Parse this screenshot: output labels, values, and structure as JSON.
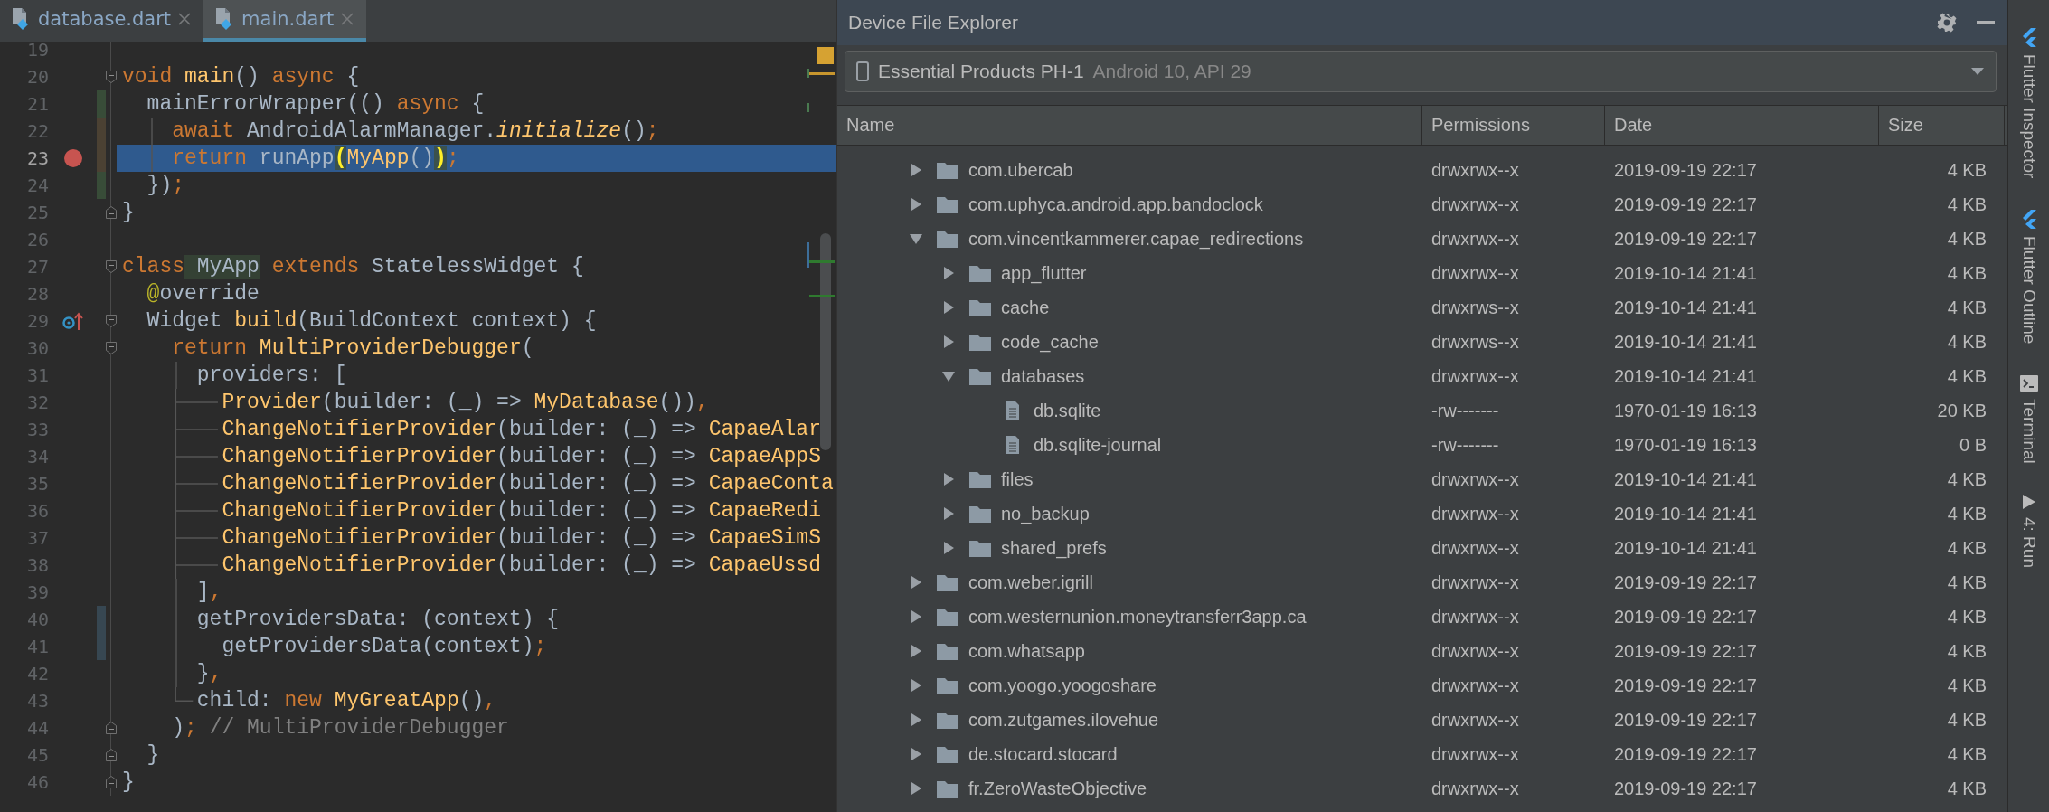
{
  "editor": {
    "tabs": [
      {
        "label": "database.dart",
        "selected": false
      },
      {
        "label": "main.dart",
        "selected": true
      }
    ],
    "lines": [
      {
        "number": "19",
        "current": false,
        "breakpoint": false,
        "override": false
      },
      {
        "number": "20",
        "current": false,
        "breakpoint": false,
        "override": false,
        "fold": {
          "end": false
        },
        "tokens": [
          {
            "kind": "kw",
            "text": "void"
          },
          {
            "kind": "fn",
            "text": " main"
          },
          {
            "kind": "plain",
            "text": "() "
          },
          {
            "kind": "kw",
            "text": "async"
          },
          {
            "kind": "plain",
            "text": " {"
          }
        ]
      },
      {
        "number": "21",
        "current": false,
        "breakpoint": false,
        "override": false,
        "change_marker": {
          "color": "#384c38"
        },
        "tokens": [
          {
            "kind": "plain",
            "text": "  mainErrorWrapper(() "
          },
          {
            "kind": "kw",
            "text": "async"
          },
          {
            "kind": "plain",
            "text": " {"
          }
        ]
      },
      {
        "number": "22",
        "current": false,
        "breakpoint": false,
        "override": false,
        "change_marker": {
          "color": "#4b4133"
        },
        "guide": {
          "branch": false
        },
        "tokens": [
          {
            "kind": "kw",
            "text": "    await"
          },
          {
            "kind": "plain",
            "text": " AndroidAlarmManager."
          },
          {
            "kind": "italic",
            "text": "initialize"
          },
          {
            "kind": "plain",
            "text": "()"
          },
          {
            "kind": "kw",
            "text": ";"
          }
        ]
      },
      {
        "number": "23",
        "current": true,
        "breakpoint": true,
        "override": false,
        "change_marker": {
          "color": "#4b4133"
        },
        "guide": {
          "branch": false
        },
        "tokens": [
          {
            "kind": "kw",
            "text": "    return"
          },
          {
            "kind": "plain",
            "text": " runApp"
          },
          {
            "kind": "brace",
            "text": "("
          },
          {
            "kind": "fn",
            "text": "MyApp"
          },
          {
            "kind": "plain",
            "text": "()"
          },
          {
            "kind": "brace",
            "text": ")"
          },
          {
            "kind": "kw",
            "text": ";"
          }
        ]
      },
      {
        "number": "24",
        "current": false,
        "breakpoint": false,
        "override": false,
        "change_marker": {
          "color": "#384c38"
        },
        "tokens": [
          {
            "kind": "plain",
            "text": "  })"
          },
          {
            "kind": "kw",
            "text": ";"
          }
        ]
      },
      {
        "number": "25",
        "current": false,
        "breakpoint": false,
        "override": false,
        "fold": {
          "end": true
        },
        "tokens": [
          {
            "kind": "plain",
            "text": "}"
          }
        ]
      },
      {
        "number": "26",
        "current": false,
        "breakpoint": false,
        "override": false
      },
      {
        "number": "27",
        "current": false,
        "breakpoint": false,
        "override": false,
        "fold": {
          "end": false
        },
        "tokens": [
          {
            "kind": "kw",
            "text": "class"
          },
          {
            "kind": "decl",
            "text": " MyApp"
          },
          {
            "kind": "kw",
            "text": " extends"
          },
          {
            "kind": "plain",
            "text": " StatelessWidget {"
          }
        ]
      },
      {
        "number": "28",
        "current": false,
        "breakpoint": false,
        "override": false,
        "tokens": [
          {
            "kind": "anno",
            "text": "  @"
          },
          {
            "kind": "plain",
            "text": "override"
          }
        ]
      },
      {
        "number": "29",
        "current": false,
        "breakpoint": false,
        "override": true,
        "fold": {
          "end": false
        },
        "tokens": [
          {
            "kind": "plain",
            "text": "  Widget "
          },
          {
            "kind": "fn",
            "text": "build"
          },
          {
            "kind": "plain",
            "text": "(BuildContext context) {"
          }
        ]
      },
      {
        "number": "30",
        "current": false,
        "breakpoint": false,
        "override": false,
        "fold": {
          "end": false
        },
        "tokens": [
          {
            "kind": "kw",
            "text": "    return"
          },
          {
            "kind": "fn",
            "text": " MultiProviderDebugger"
          },
          {
            "kind": "plain",
            "text": "("
          }
        ]
      },
      {
        "number": "31",
        "current": false,
        "breakpoint": false,
        "override": false,
        "guide": {
          "branch": false
        },
        "tokens": [
          {
            "kind": "plain",
            "text": "      providers: ["
          }
        ]
      },
      {
        "number": "32",
        "current": false,
        "breakpoint": false,
        "override": false,
        "guide": {
          "branch": true
        },
        "tokens": [
          {
            "kind": "fn",
            "text": "        Provider"
          },
          {
            "kind": "plain",
            "text": "(builder: (_) => "
          },
          {
            "kind": "fn",
            "text": "MyDatabase"
          },
          {
            "kind": "plain",
            "text": "())"
          },
          {
            "kind": "kw",
            "text": ","
          }
        ]
      },
      {
        "number": "33",
        "current": false,
        "breakpoint": false,
        "override": false,
        "guide": {
          "branch": true
        },
        "tokens": [
          {
            "kind": "fn",
            "text": "        ChangeNotifierProvider"
          },
          {
            "kind": "plain",
            "text": "(builder: (_) => "
          },
          {
            "kind": "fn",
            "text": "CapaeAlar"
          }
        ]
      },
      {
        "number": "34",
        "current": false,
        "breakpoint": false,
        "override": false,
        "guide": {
          "branch": true
        },
        "tokens": [
          {
            "kind": "fn",
            "text": "        ChangeNotifierProvider"
          },
          {
            "kind": "plain",
            "text": "(builder: (_) => "
          },
          {
            "kind": "fn",
            "text": "CapaeAppS"
          }
        ]
      },
      {
        "number": "35",
        "current": false,
        "breakpoint": false,
        "override": false,
        "guide": {
          "branch": true
        },
        "tokens": [
          {
            "kind": "fn",
            "text": "        ChangeNotifierProvider"
          },
          {
            "kind": "plain",
            "text": "(builder: (_) => "
          },
          {
            "kind": "fn",
            "text": "CapaeConta"
          }
        ]
      },
      {
        "number": "36",
        "current": false,
        "breakpoint": false,
        "override": false,
        "guide": {
          "branch": true
        },
        "tokens": [
          {
            "kind": "fn",
            "text": "        ChangeNotifierProvider"
          },
          {
            "kind": "plain",
            "text": "(builder: (_) => "
          },
          {
            "kind": "fn",
            "text": "CapaeRedi"
          }
        ]
      },
      {
        "number": "37",
        "current": false,
        "breakpoint": false,
        "override": false,
        "guide": {
          "branch": true
        },
        "tokens": [
          {
            "kind": "fn",
            "text": "        ChangeNotifierProvider"
          },
          {
            "kind": "plain",
            "text": "(builder: (_) => "
          },
          {
            "kind": "fn",
            "text": "CapaeSimS"
          }
        ]
      },
      {
        "number": "38",
        "current": false,
        "breakpoint": false,
        "override": false,
        "guide": {
          "branch": true
        },
        "tokens": [
          {
            "kind": "fn",
            "text": "        ChangeNotifierProvider"
          },
          {
            "kind": "plain",
            "text": "(builder: (_) => "
          },
          {
            "kind": "fn",
            "text": "CapaeUssd"
          }
        ]
      },
      {
        "number": "39",
        "current": false,
        "breakpoint": false,
        "override": false,
        "guide": {
          "branch": false
        },
        "tokens": [
          {
            "kind": "plain",
            "text": "      ]"
          },
          {
            "kind": "kw",
            "text": ","
          }
        ]
      },
      {
        "number": "40",
        "current": false,
        "breakpoint": false,
        "override": false,
        "change_marker": {
          "color": "#374752"
        },
        "guide": {
          "branch": false
        },
        "tokens": [
          {
            "kind": "plain",
            "text": "      getProvidersData: (context) {"
          }
        ]
      },
      {
        "number": "41",
        "current": false,
        "breakpoint": false,
        "override": false,
        "change_marker": {
          "color": "#374752"
        },
        "guide": {
          "branch": false
        },
        "tokens": [
          {
            "kind": "plain",
            "text": "        getProvidersData(context)"
          },
          {
            "kind": "kw",
            "text": ";"
          }
        ]
      },
      {
        "number": "42",
        "current": false,
        "breakpoint": false,
        "override": false,
        "guide": {
          "branch": false
        },
        "tokens": [
          {
            "kind": "plain",
            "text": "      }"
          },
          {
            "kind": "kw",
            "text": ","
          }
        ]
      },
      {
        "number": "43",
        "current": false,
        "breakpoint": false,
        "override": false,
        "guide": {
          "branch": true
        },
        "tokens": [
          {
            "kind": "plain",
            "text": "      child: "
          },
          {
            "kind": "kw",
            "text": "new"
          },
          {
            "kind": "fn",
            "text": " MyGreatApp"
          },
          {
            "kind": "plain",
            "text": "()"
          },
          {
            "kind": "kw",
            "text": ","
          }
        ]
      },
      {
        "number": "44",
        "current": false,
        "breakpoint": false,
        "override": false,
        "fold": {
          "end": true
        },
        "tokens": [
          {
            "kind": "plain",
            "text": "    )"
          },
          {
            "kind": "kw",
            "text": ";"
          },
          {
            "kind": "comment",
            "text": " // MultiProviderDebugger"
          }
        ]
      },
      {
        "number": "45",
        "current": false,
        "breakpoint": false,
        "override": false,
        "fold": {
          "end": true
        },
        "tokens": [
          {
            "kind": "plain",
            "text": "  }"
          }
        ]
      },
      {
        "number": "46",
        "current": false,
        "breakpoint": false,
        "override": false,
        "fold": {
          "end": true
        },
        "tokens": [
          {
            "kind": "plain",
            "text": "}"
          }
        ]
      }
    ]
  },
  "explorer": {
    "title": "Device File Explorer",
    "device": {
      "name": "Essential Products PH-1",
      "detail": "Android 10, API 29"
    },
    "columns": [
      "Name",
      "Permissions",
      "Date",
      "Size"
    ],
    "rows": [
      {
        "name": "com.ubercab",
        "kind": "folder",
        "expanded": false,
        "permissions": "drwxrwx--x",
        "date": "2019-09-19 22:17",
        "size": "4 KB"
      },
      {
        "name": "com.uphyca.android.app.bandoclock",
        "kind": "folder",
        "expanded": false,
        "permissions": "drwxrwx--x",
        "date": "2019-09-19 22:17",
        "size": "4 KB"
      },
      {
        "name": "com.vincentkammerer.capae_redirections",
        "kind": "folder",
        "expanded": true,
        "permissions": "drwxrwx--x",
        "date": "2019-09-19 22:17",
        "size": "4 KB",
        "children": [
          {
            "name": "app_flutter",
            "kind": "folder",
            "expanded": false,
            "permissions": "drwxrwx--x",
            "date": "2019-10-14 21:41",
            "size": "4 KB"
          },
          {
            "name": "cache",
            "kind": "folder",
            "expanded": false,
            "permissions": "drwxrws--x",
            "date": "2019-10-14 21:41",
            "size": "4 KB"
          },
          {
            "name": "code_cache",
            "kind": "folder",
            "expanded": false,
            "permissions": "drwxrws--x",
            "date": "2019-10-14 21:41",
            "size": "4 KB"
          },
          {
            "name": "databases",
            "kind": "folder",
            "expanded": true,
            "permissions": "drwxrwx--x",
            "date": "2019-10-14 21:41",
            "size": "4 KB",
            "children": [
              {
                "name": "db.sqlite",
                "kind": "file",
                "permissions": "-rw-------",
                "date": "1970-01-19 16:13",
                "size": "20 KB"
              },
              {
                "name": "db.sqlite-journal",
                "kind": "file",
                "permissions": "-rw-------",
                "date": "1970-01-19 16:13",
                "size": "0 B"
              }
            ]
          },
          {
            "name": "files",
            "kind": "folder",
            "expanded": false,
            "permissions": "drwxrwx--x",
            "date": "2019-10-14 21:41",
            "size": "4 KB"
          },
          {
            "name": "no_backup",
            "kind": "folder",
            "expanded": false,
            "permissions": "drwxrwx--x",
            "date": "2019-10-14 21:41",
            "size": "4 KB"
          },
          {
            "name": "shared_prefs",
            "kind": "folder",
            "expanded": false,
            "permissions": "drwxrwx--x",
            "date": "2019-10-14 21:41",
            "size": "4 KB"
          }
        ]
      },
      {
        "name": "com.weber.igrill",
        "kind": "folder",
        "expanded": false,
        "permissions": "drwxrwx--x",
        "date": "2019-09-19 22:17",
        "size": "4 KB"
      },
      {
        "name": "com.westernunion.moneytransferr3app.ca",
        "kind": "folder",
        "expanded": false,
        "permissions": "drwxrwx--x",
        "date": "2019-09-19 22:17",
        "size": "4 KB"
      },
      {
        "name": "com.whatsapp",
        "kind": "folder",
        "expanded": false,
        "permissions": "drwxrwx--x",
        "date": "2019-09-19 22:17",
        "size": "4 KB"
      },
      {
        "name": "com.yoogo.yoogoshare",
        "kind": "folder",
        "expanded": false,
        "permissions": "drwxrwx--x",
        "date": "2019-09-19 22:17",
        "size": "4 KB"
      },
      {
        "name": "com.zutgames.ilovehue",
        "kind": "folder",
        "expanded": false,
        "permissions": "drwxrwx--x",
        "date": "2019-09-19 22:17",
        "size": "4 KB"
      },
      {
        "name": "de.stocard.stocard",
        "kind": "folder",
        "expanded": false,
        "permissions": "drwxrwx--x",
        "date": "2019-09-19 22:17",
        "size": "4 KB"
      },
      {
        "name": "fr.ZeroWasteObjective",
        "kind": "folder",
        "expanded": false,
        "permissions": "drwxrwx--x",
        "date": "2019-09-19 22:17",
        "size": "4 KB"
      }
    ]
  },
  "side_tabs": [
    {
      "label": "Flutter Inspector",
      "kind": "flutter"
    },
    {
      "label": "Flutter Outline",
      "kind": "flutter"
    },
    {
      "label": "Terminal",
      "kind": "terminal"
    },
    {
      "label": "4: Run",
      "kind": "run"
    }
  ]
}
